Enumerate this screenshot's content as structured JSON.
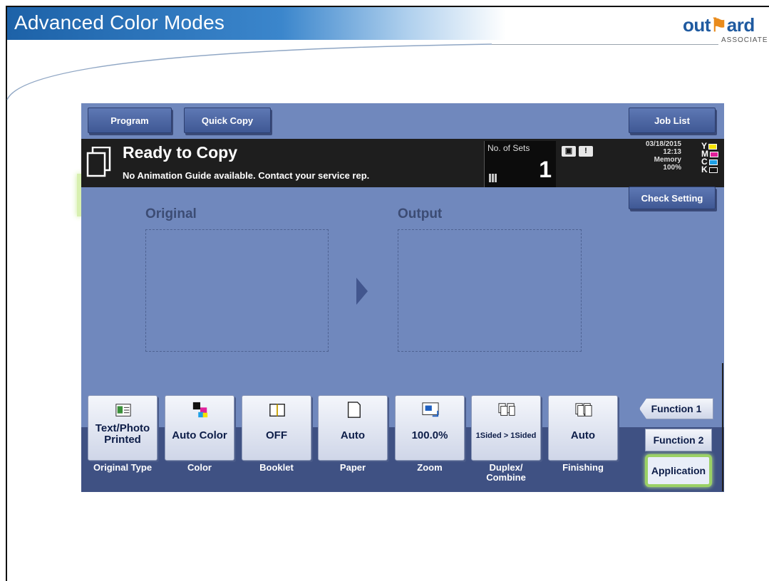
{
  "slide": {
    "title": "Advanced  Color Modes",
    "logo_left": "out",
    "logo_wing": "⚑",
    "logo_right": "ard",
    "logo_sub": "ASSOCIATE"
  },
  "panel": {
    "top_buttons": {
      "program": "Program",
      "quick_copy": "Quick Copy",
      "job_list": "Job List"
    },
    "status": {
      "title": "Ready to Copy",
      "message": "No Animation Guide available. Contact your service rep.",
      "sets_label": "No. of Sets",
      "sets_value": "1",
      "date": "03/18/2015",
      "time": "12:13",
      "memory_label": "Memory",
      "memory_value": "100%",
      "toner": [
        {
          "letter": "Y",
          "color": "#f5e300"
        },
        {
          "letter": "M",
          "color": "#e0209a"
        },
        {
          "letter": "C",
          "color": "#1ea0e6"
        },
        {
          "letter": "K",
          "color": "#111111"
        }
      ]
    },
    "check_setting": "Check Setting",
    "original_label": "Original",
    "output_label": "Output",
    "functions": [
      {
        "value": "Text/Photo\nPrinted",
        "caption": "Original Type",
        "icon": "original-type-icon"
      },
      {
        "value": "Auto Color",
        "caption": "Color",
        "icon": "color-icon"
      },
      {
        "value": "OFF",
        "caption": "Booklet",
        "icon": "booklet-icon"
      },
      {
        "value": "Auto",
        "caption": "Paper",
        "icon": "paper-icon"
      },
      {
        "value": "100.0%",
        "caption": "Zoom",
        "icon": "zoom-icon"
      },
      {
        "value": "1Sided > 1Sided",
        "caption": "Duplex/\nCombine",
        "icon": "duplex-icon"
      },
      {
        "value": "Auto",
        "caption": "Finishing",
        "icon": "finishing-icon"
      }
    ],
    "side": {
      "function1": "Function 1",
      "function2": "Function 2",
      "application": "Application"
    }
  }
}
